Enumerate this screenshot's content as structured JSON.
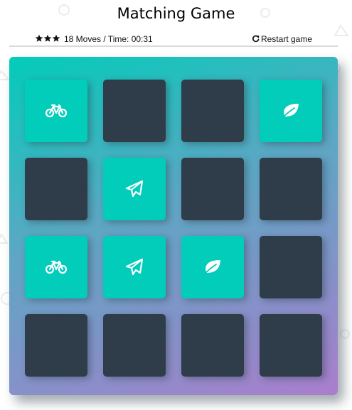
{
  "title": "Matching Game",
  "score_panel": {
    "stars": 3,
    "star_icon": "star-icon",
    "moves_text": "18 Moves / Time: 00:31",
    "restart_label": "Restart game",
    "restart_icon": "redo-icon"
  },
  "colors": {
    "card_hidden": "#2e3d49",
    "card_matched": "#02ccba",
    "deck_gradient_start": "#02ccba",
    "deck_gradient_end": "#aa7ecd"
  },
  "deck": {
    "rows": [
      [
        {
          "state": "matched",
          "icon": "bicycle-icon"
        },
        {
          "state": "hidden",
          "icon": ""
        },
        {
          "state": "hidden",
          "icon": ""
        },
        {
          "state": "matched",
          "icon": "leaf-icon"
        }
      ],
      [
        {
          "state": "hidden",
          "icon": ""
        },
        {
          "state": "matched",
          "icon": "paper-plane-icon"
        },
        {
          "state": "hidden",
          "icon": ""
        },
        {
          "state": "hidden",
          "icon": ""
        }
      ],
      [
        {
          "state": "matched",
          "icon": "bicycle-icon"
        },
        {
          "state": "matched",
          "icon": "paper-plane-icon"
        },
        {
          "state": "matched",
          "icon": "leaf-icon"
        },
        {
          "state": "hidden",
          "icon": ""
        }
      ],
      [
        {
          "state": "hidden",
          "icon": ""
        },
        {
          "state": "hidden",
          "icon": ""
        },
        {
          "state": "hidden",
          "icon": ""
        },
        {
          "state": "hidden",
          "icon": ""
        }
      ]
    ]
  }
}
